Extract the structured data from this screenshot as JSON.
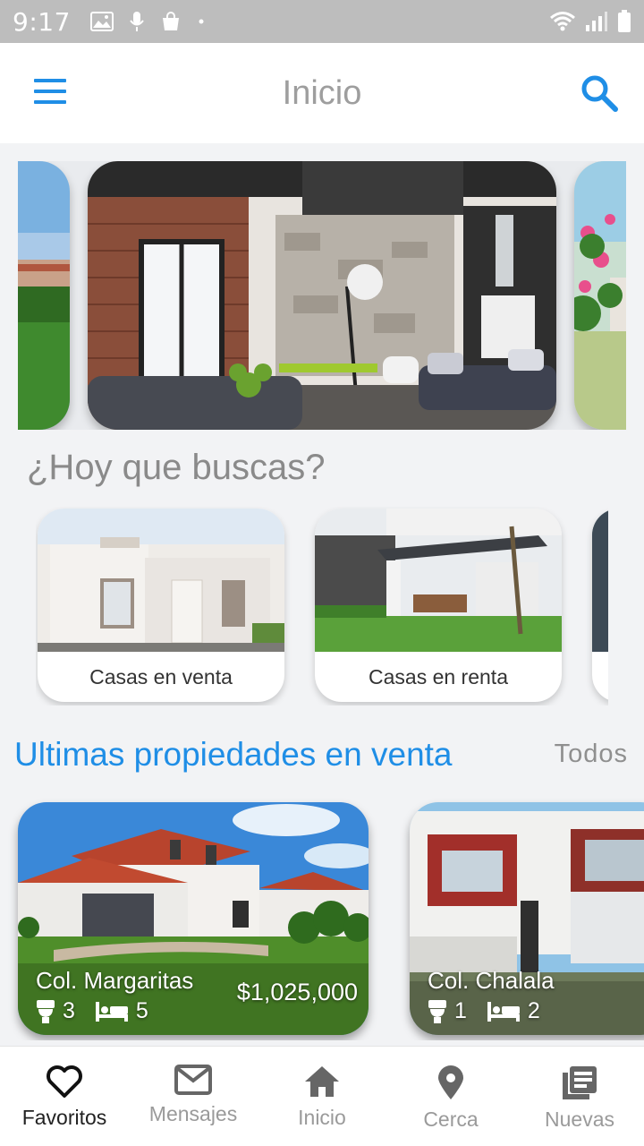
{
  "status_bar": {
    "time": "9:17"
  },
  "app_bar": {
    "title": "Inicio",
    "accent": "#1f8ee6"
  },
  "categories": {
    "heading": "¿Hoy que buscas?",
    "items": [
      {
        "label": "Casas en venta"
      },
      {
        "label": "Casas en renta"
      }
    ]
  },
  "latest": {
    "heading": "Ultimas propiedades en venta",
    "see_all": "Todos",
    "properties": [
      {
        "colony": "Col. Margaritas",
        "baths": "3",
        "beds": "5",
        "price": "$1,025,000"
      },
      {
        "colony": "Col. Chalala",
        "baths": "1",
        "beds": "2",
        "price": ""
      }
    ]
  },
  "bottom_nav": {
    "items": [
      {
        "label": "Favoritos",
        "icon": "heart-icon",
        "active": true
      },
      {
        "label": "Mensajes",
        "icon": "mail-icon"
      },
      {
        "label": "Inicio",
        "icon": "home-icon"
      },
      {
        "label": "Cerca",
        "icon": "location-pin-icon"
      },
      {
        "label": "Nuevas",
        "icon": "news-icon"
      }
    ]
  }
}
